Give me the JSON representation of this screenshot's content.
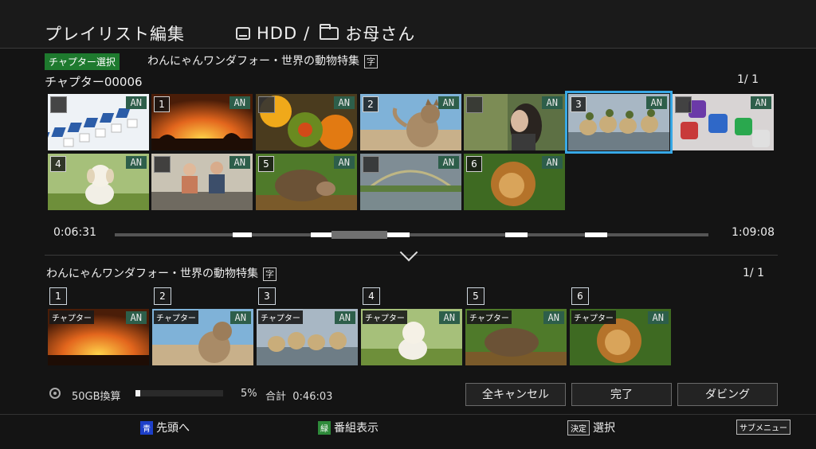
{
  "header": {
    "title": "プレイリスト編集",
    "drive": "HDD",
    "separator": "/",
    "folder": "お母さん"
  },
  "edit_mode": {
    "badge": "チャプター選択",
    "program_title": "わんにゃんワンダフォー・世界の動物特集",
    "subtitle_mark": "字",
    "chapter_name": "チャプター00006",
    "page": "1/  1"
  },
  "chapters_grid": [
    {
      "badge": "AN",
      "number": "",
      "image": "abstract-cubes"
    },
    {
      "badge": "AN",
      "number": "1",
      "image": "title-card-sunset"
    },
    {
      "badge": "AN",
      "number": "",
      "image": "pumpkins"
    },
    {
      "badge": "AN",
      "number": "2",
      "image": "cat-beach"
    },
    {
      "badge": "AN",
      "number": "",
      "image": "woman-portrait"
    },
    {
      "badge": "AN",
      "number": "3",
      "image": "ducks",
      "selected": true
    },
    {
      "badge": "AN",
      "number": "",
      "image": "dice"
    },
    {
      "badge": "AN",
      "number": "4",
      "image": "puppy"
    },
    {
      "badge": "AN",
      "number": "",
      "image": "cooking"
    },
    {
      "badge": "AN",
      "number": "5",
      "image": "hedgehog"
    },
    {
      "badge": "AN",
      "number": "",
      "image": "rainbow-lake"
    },
    {
      "badge": "AN",
      "number": "6",
      "image": "lion"
    }
  ],
  "timeline": {
    "current": "0:06:31",
    "total": "1:09:08"
  },
  "playlist": {
    "title": "わんにゃんワンダフォー・世界の動物特集",
    "subtitle_mark": "字",
    "page": "1/  1",
    "items": [
      {
        "number": "1",
        "label": "チャプター",
        "badge": "AN",
        "image": "title-card-sunset"
      },
      {
        "number": "2",
        "label": "チャプター",
        "badge": "AN",
        "image": "cat-beach"
      },
      {
        "number": "3",
        "label": "チャプター",
        "badge": "AN",
        "image": "ducks"
      },
      {
        "number": "4",
        "label": "チャプター",
        "badge": "AN",
        "image": "puppy"
      },
      {
        "number": "5",
        "label": "チャプター",
        "badge": "AN",
        "image": "hedgehog"
      },
      {
        "number": "6",
        "label": "チャプター",
        "badge": "AN",
        "image": "lion"
      }
    ]
  },
  "capacity": {
    "label": "50GB換算",
    "percent_value": 0.05,
    "percent": "5%",
    "total_label": "合計",
    "total": "0:46:03"
  },
  "buttons": {
    "cancel_all": "全キャンセル",
    "done": "完了",
    "dubbing": "ダビング"
  },
  "footer": {
    "blue_key": "青",
    "blue_label": "先頭へ",
    "green_key": "緑",
    "green_label": "番組表示",
    "enter_key": "決定",
    "enter_label": "選択",
    "submenu_key": "サブメニュー"
  },
  "colors": {
    "accent_selection": "#38a8e6",
    "an_badge": "#2d5e4a",
    "mode_badge": "#1e7a2e",
    "blue_key": "#1d3fc8",
    "green_key": "#2e8a3a"
  }
}
